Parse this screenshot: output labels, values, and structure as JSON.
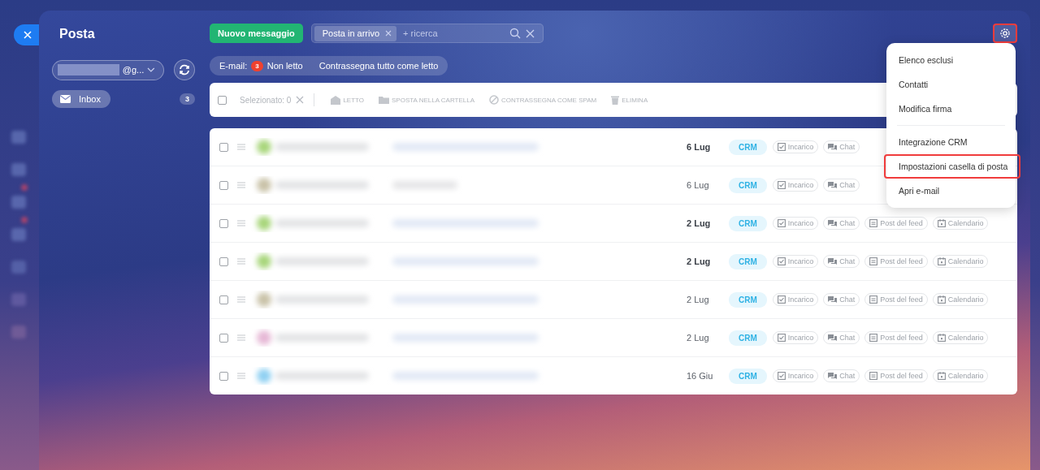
{
  "app_title": "Posta",
  "account": {
    "value": "@g..."
  },
  "folders": [
    {
      "label": "Inbox",
      "count": "3",
      "selected": true
    }
  ],
  "new_message_button": "Nuovo messaggio",
  "search": {
    "chip": "Posta in arrivo",
    "placeholder": "+ ricerca"
  },
  "settings_button": {
    "highlighted": true
  },
  "counters": {
    "label": "E-mail:",
    "badge": "3",
    "unread": "Non letto",
    "mark_all": "Contrassegna tutto come letto"
  },
  "toolbar": {
    "select_all_checked": false,
    "selected": "Selezionato: 0",
    "actions": [
      "LETTO",
      "SPOSTA NELLA CARTELLA",
      "CONTRASSEGNA COME SPAM",
      "ELIMINA"
    ]
  },
  "rows": [
    {
      "checked": false,
      "date": "6 Lug",
      "unread": true,
      "tag": "CRM",
      "actions": [
        "Incarico",
        "Chat"
      ]
    },
    {
      "checked": false,
      "date": "6 Lug",
      "unread": false,
      "tag": "CRM",
      "actions": [
        "Incarico",
        "Chat"
      ]
    },
    {
      "checked": false,
      "date": "2 Lug",
      "unread": true,
      "tag": "CRM",
      "actions": [
        "Incarico",
        "Chat",
        "Post del feed",
        "Calendario"
      ]
    },
    {
      "checked": false,
      "date": "2 Lug",
      "unread": true,
      "tag": "CRM",
      "actions": [
        "Incarico",
        "Chat",
        "Post del feed",
        "Calendario"
      ]
    },
    {
      "checked": false,
      "date": "2 Lug",
      "unread": false,
      "tag": "CRM",
      "actions": [
        "Incarico",
        "Chat",
        "Post del feed",
        "Calendario"
      ]
    },
    {
      "checked": false,
      "date": "2 Lug",
      "unread": false,
      "tag": "CRM",
      "actions": [
        "Incarico",
        "Chat",
        "Post del feed",
        "Calendario"
      ]
    },
    {
      "checked": false,
      "date": "16 Giu",
      "unread": false,
      "tag": "CRM",
      "actions": [
        "Incarico",
        "Chat",
        "Post del feed",
        "Calendario"
      ]
    }
  ],
  "settings_menu": [
    {
      "kind": "item",
      "label": "Elenco esclusi",
      "highlighted": false
    },
    {
      "kind": "item",
      "label": "Contatti",
      "highlighted": false
    },
    {
      "kind": "item",
      "label": "Modifica firma",
      "highlighted": false
    },
    {
      "kind": "separator"
    },
    {
      "kind": "item",
      "label": "Integrazione CRM",
      "highlighted": false
    },
    {
      "kind": "item",
      "label": "Impostazioni casella di posta",
      "highlighted": true
    },
    {
      "kind": "item",
      "label": "Apri e-mail",
      "highlighted": false
    }
  ]
}
